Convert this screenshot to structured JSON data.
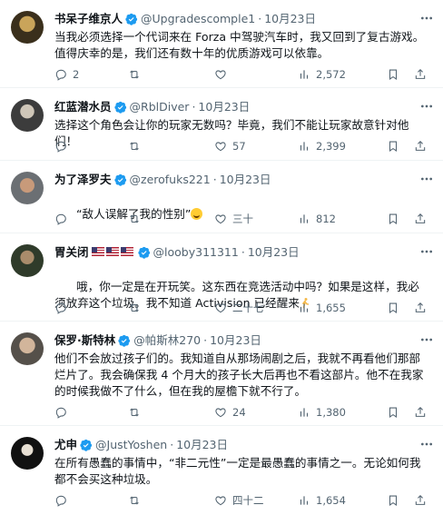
{
  "tweets": [
    {
      "name": "书呆子维京人",
      "handle": "@Upgradescomple1",
      "dot": "·",
      "time": "10月23日",
      "body": "当我必须选择一个代词来在 Forza 中驾驶汽车时，我又回到了复古游戏。值得庆幸的是，我们还有数十年的优质游戏可以依靠。",
      "replies": "2",
      "retweets": "",
      "likes": "",
      "views": "2,572",
      "avatar_color": "#3a2f1c"
    },
    {
      "name": "红蓝潜水员",
      "handle": "@RblDiver",
      "dot": "·",
      "time": "10月23日",
      "body": "选择这个角色会让你的玩家无数吗？毕竟，我们不能让玩家故意针对他们！",
      "replies": "",
      "retweets": "",
      "likes": "57",
      "views": "2,399",
      "avatar_color": "#4a4a4a"
    },
    {
      "name": "为了泽罗夫",
      "handle": "@zerofuks221",
      "dot": "·",
      "time": "10月23日",
      "body": "“敌人误解了我的性别”",
      "emoji": "rofl-emoji",
      "replies": "",
      "retweets": "",
      "likes": "三十",
      "views": "812",
      "avatar_color": "#6b6f73"
    },
    {
      "name": "胃关闭",
      "handle": "@looby311311",
      "dot": "·",
      "time": "10月23日",
      "body": "哦，你一定是在开玩笑。这东西在竞选活动中吗？如果是这样，我必须放弃这个垃圾。我不知道 Activision 已经醒来",
      "emoji": "running-emoji",
      "flags": "🇺🇸🇺🇸🇺🇸",
      "replies": "",
      "retweets": "",
      "likes": "二十七",
      "views": "1,655",
      "avatar_color": "#2f3b2a"
    },
    {
      "name": "保罗·斯特林",
      "handle": "@帕斯林270",
      "dot": "·",
      "time": "10月23日",
      "body": "他们不会放过孩子们的。我知道自从那场闹剧之后，我就不再看他们那部烂片了。我会确保我 4 个月大的孩子长大后再也不看这部片。他不在我家的时候我做不了什么，但在我的屋檐下就不行了。",
      "replies": "",
      "retweets": "",
      "likes": "24",
      "views": "1,380",
      "avatar_color": "#55504a"
    },
    {
      "name": "尤申",
      "handle": "@JustYoshen",
      "dot": "·",
      "time": "10月23日",
      "body": "在所有愚蠢的事情中，“非二元性”一定是最愚蠢的事情之一。无论如何我都不会买这种垃圾。",
      "replies": "",
      "retweets": "",
      "likes": "四十二",
      "views": "1,654",
      "avatar_color": "#111111"
    }
  ],
  "colors": {
    "verified": "#1d9bf0",
    "meta": "#536471",
    "text": "#0f1419",
    "divider": "#eff3f4"
  }
}
